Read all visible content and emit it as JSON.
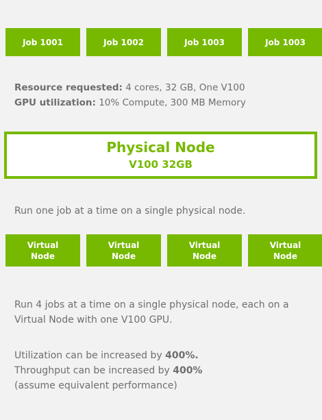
{
  "jobs": [
    {
      "label": "Job 1001"
    },
    {
      "label": "Job 1002"
    },
    {
      "label": "Job 1003"
    },
    {
      "label": "Job 1003"
    }
  ],
  "resource": {
    "requested_label": "Resource requested:",
    "requested_value": " 4 cores, 32 GB, One V100",
    "gpu_label": "GPU utilization:",
    "gpu_value": " 10% Compute, 300 MB Memory"
  },
  "physical_node": {
    "title": "Physical Node",
    "subtitle": "V100 32GB"
  },
  "run_one_text": "Run one job at a time on a single physical node.",
  "virtual_nodes": [
    {
      "line1": "Virtual",
      "line2": "Node"
    },
    {
      "line1": "Virtual",
      "line2": "Node"
    },
    {
      "line1": "Virtual",
      "line2": "Node"
    },
    {
      "line1": "Virtual",
      "line2": "Node"
    }
  ],
  "run_four_text": "Run 4 jobs at a time on a single physical node, each on a Virtual Node with one V100 GPU.",
  "utilization": {
    "line1_prefix": "Utilization can be increased by ",
    "line1_value": "400%.",
    "line2_prefix": "Throughput can be increased by ",
    "line2_value": "400%",
    "line3": "(assume equivalent performance)"
  },
  "colors": {
    "accent": "#76b900",
    "background": "#f2f2f2",
    "text": "#6e6e6e"
  }
}
